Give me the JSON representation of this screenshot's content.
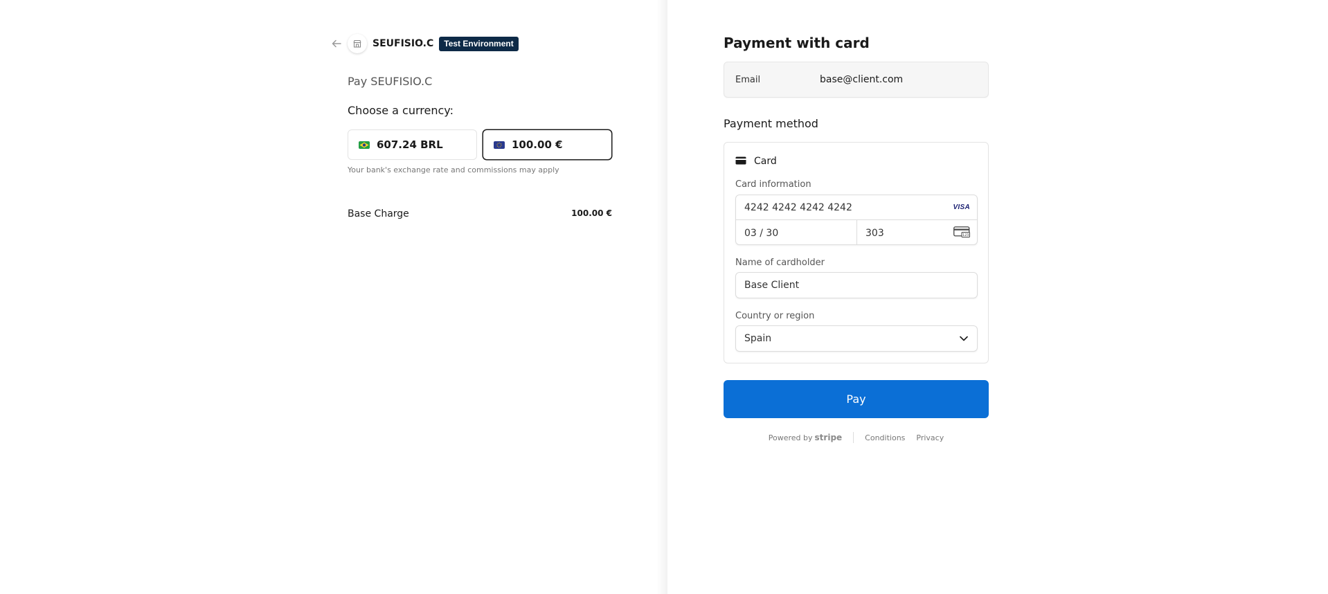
{
  "header": {
    "back_icon": "arrow-left-icon",
    "store_icon": "store-icon",
    "merchant_name": "SEUFISIO.C",
    "test_badge": "Test Environment"
  },
  "summary": {
    "pay_title": "Pay SEUFISIO.C",
    "choose_currency": "Choose a currency:",
    "currencies": [
      {
        "label": "607.24 BRL",
        "flag": "brazil-flag-icon",
        "selected": false
      },
      {
        "label": "100.00 €",
        "flag": "eu-flag-icon",
        "selected": true
      }
    ],
    "disclaimer": "Your bank's exchange rate and commissions may apply",
    "line_items": [
      {
        "name": "Base Charge",
        "amount": "100.00 €"
      }
    ]
  },
  "payment": {
    "title": "Payment with card",
    "email_label": "Email",
    "email_value": "base@client.com",
    "method_title": "Payment method",
    "card_tab_label": "Card",
    "card_info_label": "Card information",
    "card_number": "4242 4242 4242 4242",
    "card_brand": "VISA",
    "expiry": "03 / 30",
    "cvc": "303",
    "cardholder_label": "Name of cardholder",
    "cardholder_value": "Base Client",
    "country_label": "Country or region",
    "country_value": "Spain",
    "pay_button": "Pay"
  },
  "footer": {
    "powered_by": "Powered by",
    "stripe": "stripe",
    "conditions": "Conditions",
    "privacy": "Privacy"
  },
  "colors": {
    "pay_button": "#0b6fd6",
    "test_badge": "#0e2a47"
  }
}
